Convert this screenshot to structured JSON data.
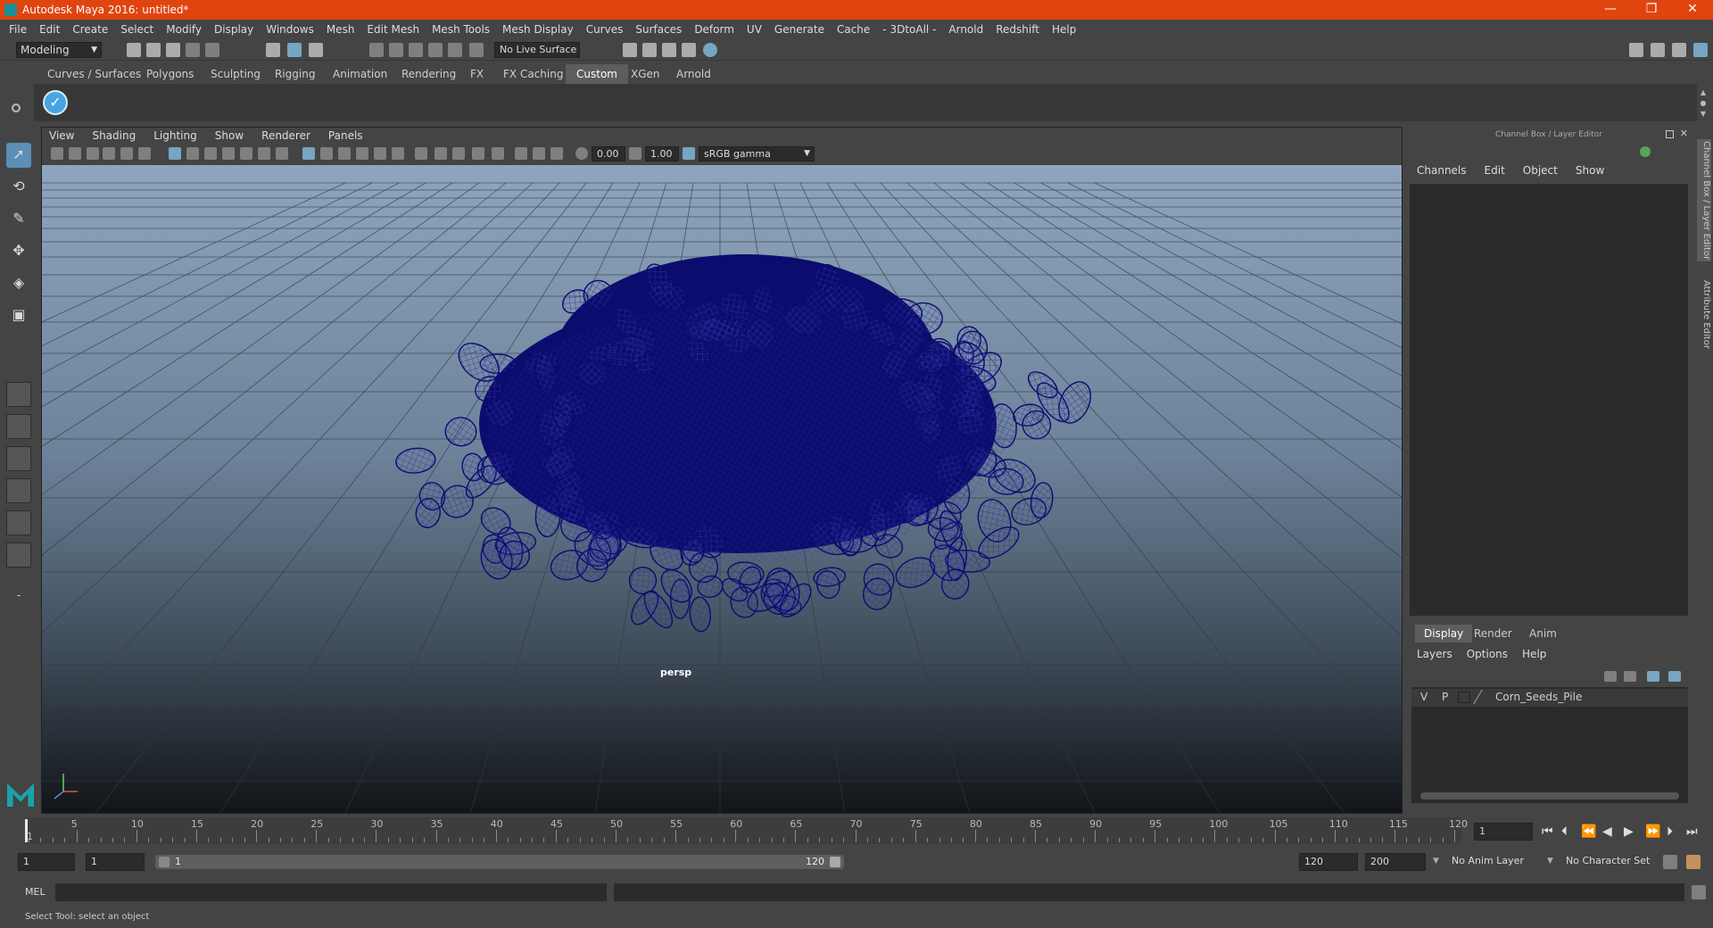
{
  "window": {
    "title": "Autodesk Maya 2016: untitled*"
  },
  "menubar": [
    "File",
    "Edit",
    "Create",
    "Select",
    "Modify",
    "Display",
    "Windows",
    "Mesh",
    "Edit Mesh",
    "Mesh Tools",
    "Mesh Display",
    "Curves",
    "Surfaces",
    "Deform",
    "UV",
    "Generate",
    "Cache",
    "- 3DtoAll -",
    "Arnold",
    "Redshift",
    "Help"
  ],
  "statusline": {
    "mode": "Modeling",
    "live_surface": "No Live Surface"
  },
  "shelf": {
    "tabs": [
      "Curves / Surfaces",
      "Polygons",
      "Sculpting",
      "Rigging",
      "Animation",
      "Rendering",
      "FX",
      "FX Caching",
      "Custom",
      "XGen",
      "Arnold"
    ],
    "active_tab": "Custom"
  },
  "viewport": {
    "menu": [
      "View",
      "Shading",
      "Lighting",
      "Show",
      "Renderer",
      "Panels"
    ],
    "exposure": "0.00",
    "gamma": "1.00",
    "color_space": "sRGB gamma",
    "camera": "persp"
  },
  "channel_box": {
    "title": "Channel Box / Layer Editor",
    "menu": [
      "Channels",
      "Edit",
      "Object",
      "Show"
    ]
  },
  "layer_editor": {
    "tabs": [
      "Display",
      "Render",
      "Anim"
    ],
    "active_tab": "Display",
    "menu": [
      "Layers",
      "Options",
      "Help"
    ],
    "layers": [
      {
        "v": "V",
        "p": "P",
        "name": "Corn_Seeds_Pile"
      }
    ]
  },
  "side_tabs": [
    "Channel Box / Layer Editor",
    "Attribute Editor"
  ],
  "timeline": {
    "ticks": [
      "5",
      "10",
      "15",
      "20",
      "25",
      "30",
      "35",
      "40",
      "45",
      "50",
      "55",
      "60",
      "65",
      "70",
      "75",
      "80",
      "85",
      "90",
      "95",
      "100",
      "105",
      "110",
      "115",
      "120"
    ],
    "first": "1",
    "current_frame": "1"
  },
  "range": {
    "start": "1",
    "anim_start": "1",
    "range_start_label": "1",
    "range_end_label": "120",
    "end": "120",
    "anim_end": "200",
    "anim_layer": "No Anim Layer",
    "character_set": "No Character Set"
  },
  "command_line": {
    "label": "MEL"
  },
  "help_line": "Select Tool: select an object",
  "colors": {
    "titlebar": "#e0440f",
    "wireframe": "#0c0c6e",
    "active_tool": "#5b8fb5"
  }
}
